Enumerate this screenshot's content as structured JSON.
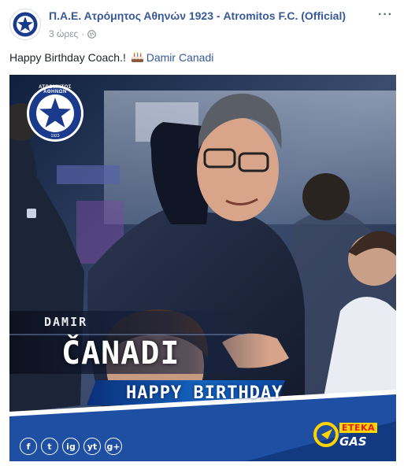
{
  "post": {
    "page_name": "Π.Α.Ε. Ατρόμητος Αθηνών 1923 - Atromitos F.C. (Official)",
    "time": "3 ώρες",
    "more_label": "···",
    "text_before": "Happy Birthday Coach.! ",
    "mention": "Damir Canadi"
  },
  "image": {
    "club_logo_text": "ΑΤΡΟΜΗΤΟΣ ΑΘΗΝΩΝ",
    "club_logo_year": "1923",
    "first_name": "DAMIR",
    "last_name": "ČANADI",
    "greeting": "HAPPY BIRTHDAY",
    "social_icons": [
      "f",
      "t",
      "ig",
      "yt",
      "g+"
    ],
    "sponsor_top": "ETEKA",
    "sponsor_bottom": "GAS"
  },
  "colors": {
    "link": "#365899",
    "banner": "#0d47a1",
    "club_blue": "#1a3a8c"
  }
}
